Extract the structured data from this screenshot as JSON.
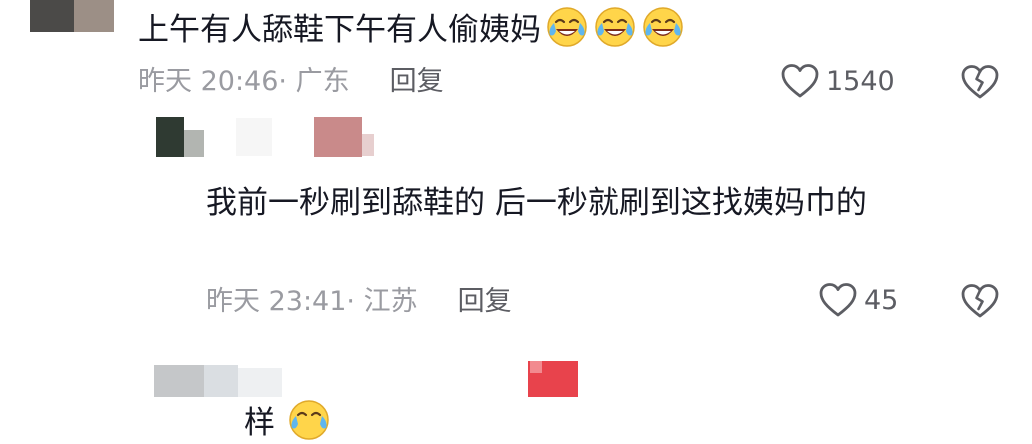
{
  "comments": [
    {
      "text": "上午有人舔鞋下午有人偷姨妈",
      "emoji": "laughing-crying-emoji",
      "time": "昨天 20:46",
      "location": "广东",
      "reply_label": "回复",
      "likes": "1540"
    },
    {
      "text": "我前一秒刷到舔鞋的  后一秒就刷到这找姨妈巾的",
      "time": "昨天 23:41",
      "location": "江苏",
      "reply_label": "回复",
      "likes": "45"
    },
    {
      "text": "样"
    }
  ],
  "colors": {
    "text": "#161823",
    "meta": "#9a9ba1",
    "action": "#5c5d63"
  }
}
